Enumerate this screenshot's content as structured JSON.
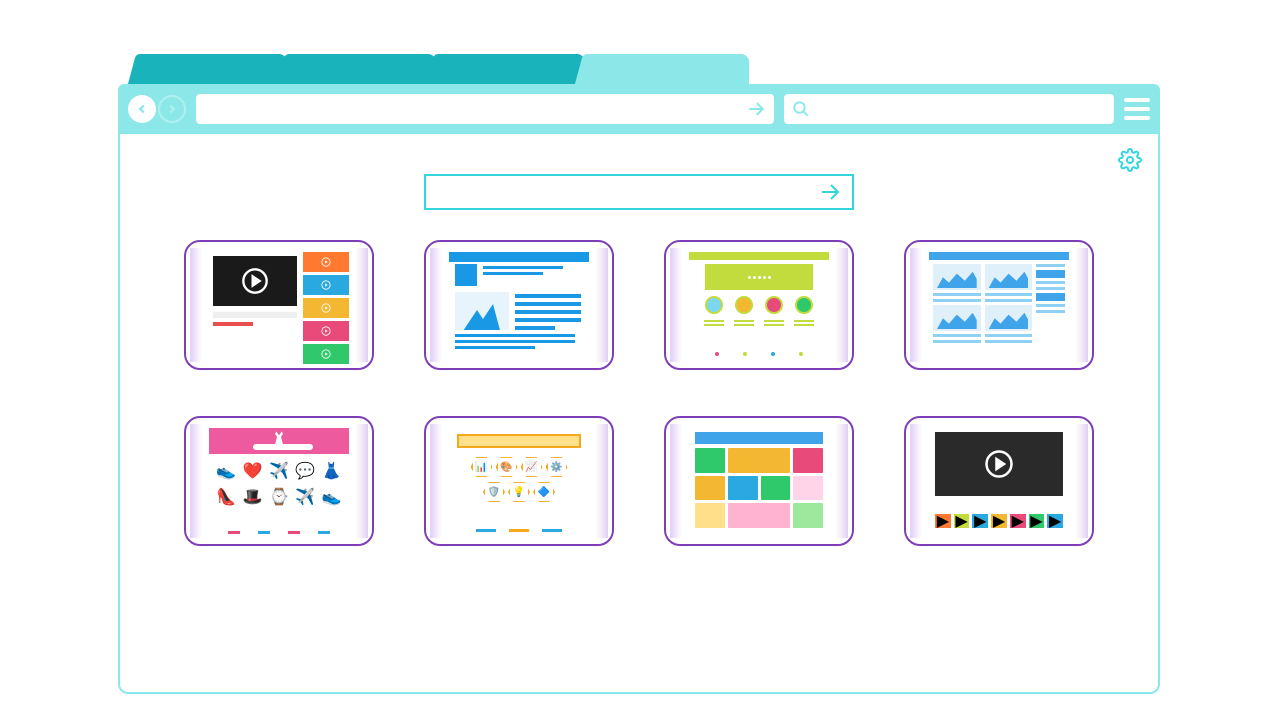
{
  "browser": {
    "tabs": [
      {
        "label": ""
      },
      {
        "label": ""
      },
      {
        "label": ""
      },
      {
        "label": "",
        "active": true
      }
    ],
    "address_bar": {
      "value": "",
      "placeholder": ""
    },
    "search_bar": {
      "value": "",
      "placeholder": ""
    }
  },
  "page": {
    "center_search": {
      "value": "",
      "placeholder": ""
    },
    "tiles": [
      {
        "name": "video-portal-thumbnail"
      },
      {
        "name": "blog-article-thumbnail"
      },
      {
        "name": "badges-portal-thumbnail"
      },
      {
        "name": "analytics-dashboard-thumbnail"
      },
      {
        "name": "ecommerce-shop-thumbnail"
      },
      {
        "name": "hex-icons-thumbnail"
      },
      {
        "name": "masonry-gallery-thumbnail"
      },
      {
        "name": "video-player-thumbnail"
      }
    ]
  },
  "colors": {
    "accent": "#8ce8e8",
    "accent_dark": "#18b3bb",
    "tile_border": "#7c3fb8"
  }
}
